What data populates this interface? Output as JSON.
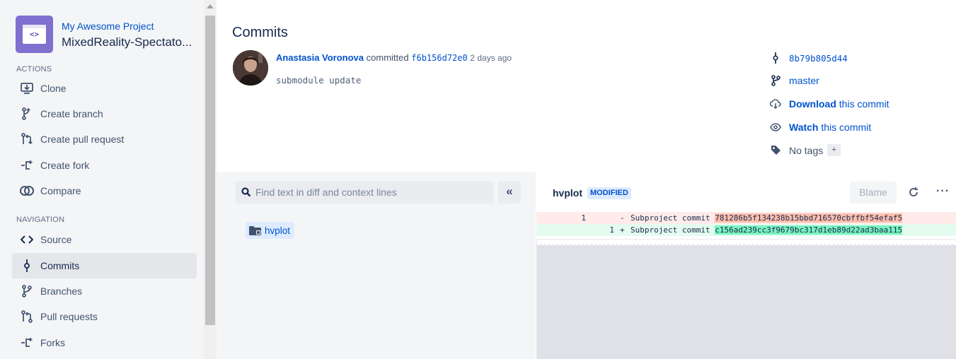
{
  "sidebar": {
    "project_group": "My Awesome Project",
    "repo_name": "MixedReality-Spectato...",
    "avatar_glyph": "<>",
    "actions_heading": "ACTIONS",
    "actions": [
      {
        "label": "Clone",
        "icon": "clone-icon"
      },
      {
        "label": "Create branch",
        "icon": "create-branch-icon"
      },
      {
        "label": "Create pull request",
        "icon": "create-pull-request-icon"
      },
      {
        "label": "Create fork",
        "icon": "create-fork-icon"
      },
      {
        "label": "Compare",
        "icon": "compare-icon"
      }
    ],
    "navigation_heading": "NAVIGATION",
    "navigation": [
      {
        "label": "Source",
        "icon": "source-icon"
      },
      {
        "label": "Commits",
        "icon": "commits-icon",
        "active": true
      },
      {
        "label": "Branches",
        "icon": "branches-icon"
      },
      {
        "label": "Pull requests",
        "icon": "pull-requests-icon"
      },
      {
        "label": "Forks",
        "icon": "forks-icon"
      }
    ]
  },
  "header": {
    "title": "Commits",
    "author": "Anastasia Voronova",
    "action": "committed",
    "commit_hash": "f6b156d72e0",
    "time": "2 days ago",
    "message": "submodule update"
  },
  "meta": {
    "parent_hash": "8b79b805d44",
    "branch": "master",
    "download_bold": "Download",
    "download_rest": "this commit",
    "watch_bold": "Watch",
    "watch_rest": "this commit",
    "tags": "No tags",
    "tag_add": "+"
  },
  "file_tree": {
    "search_placeholder": "Find text in diff and context lines",
    "collapse_label": "«",
    "files": [
      {
        "name": "hvplot",
        "icon": "submodule-folder-icon"
      }
    ]
  },
  "diff": {
    "file": "hvplot",
    "status": "MODIFIED",
    "blame_label": "Blame",
    "more_label": "···",
    "lines": [
      {
        "old": "1",
        "new": "",
        "sign": "-",
        "prefix": "Subproject commit ",
        "hash": "781286b5f134238b15bbd716570cbffbf54efaf5"
      },
      {
        "old": "",
        "new": "1",
        "sign": "+",
        "prefix": "Subproject commit ",
        "hash": "c156ad239cc3f9679bc317d1eb89d22ad3baa115"
      }
    ]
  },
  "colors": {
    "link": "#0052cc",
    "sidebar_bg": "#f4f5f7",
    "active_item": "#e4e6ea",
    "removed_bg": "#ffebe9",
    "removed_hl": "#ffbdad",
    "added_bg": "#e3fcef",
    "added_hl": "#79f2c0"
  }
}
